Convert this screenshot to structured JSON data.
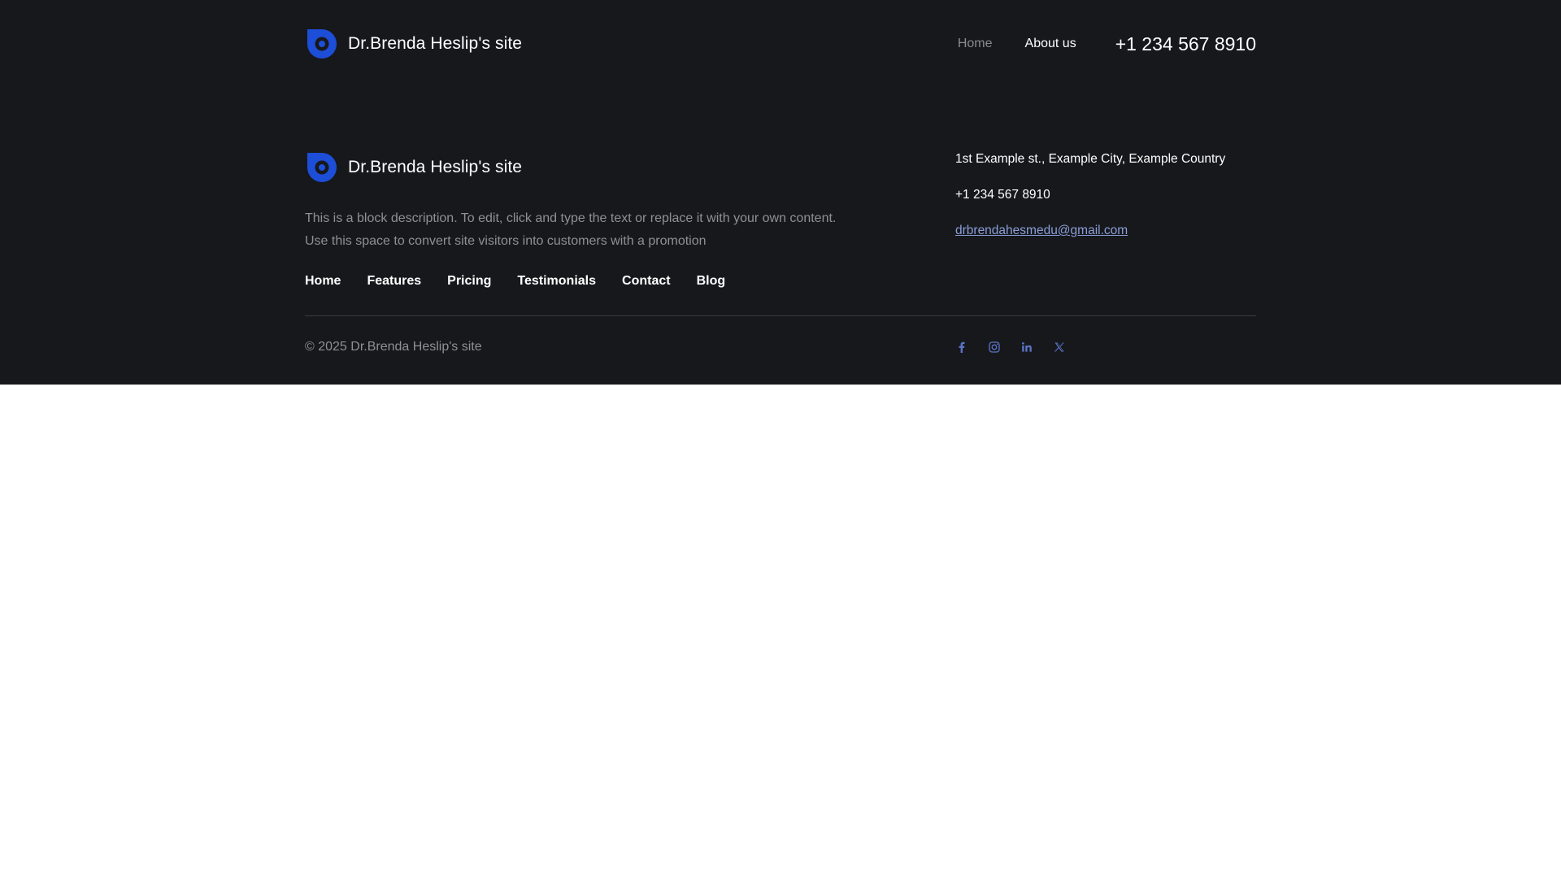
{
  "site": {
    "name": "Dr.Brenda Heslip's site",
    "accent_color": "#1d4ed8"
  },
  "header": {
    "nav": [
      {
        "label": "Home"
      },
      {
        "label": "About us"
      }
    ],
    "phone": "+1 234 567 8910"
  },
  "footer": {
    "description_line1": "This is a block description. To edit, click and type the text or replace it with your own content.",
    "description_line2": "Use this space to convert site visitors into customers with a promotion",
    "links": [
      {
        "label": "Home"
      },
      {
        "label": "Features"
      },
      {
        "label": "Pricing"
      },
      {
        "label": "Testimonials"
      },
      {
        "label": "Contact"
      },
      {
        "label": "Blog"
      }
    ],
    "address": "1st Example st., Example City, Example Country",
    "phone": "+1 234 567 8910",
    "email": "drbrendahesmedu@gmail.com",
    "copyright": "© 2025 Dr.Brenda Heslip's site",
    "social": [
      {
        "icon": "facebook-icon"
      },
      {
        "icon": "instagram-icon"
      },
      {
        "icon": "linkedin-icon"
      },
      {
        "icon": "x-twitter-icon"
      }
    ],
    "social_icon_color": "#5b74c9"
  }
}
